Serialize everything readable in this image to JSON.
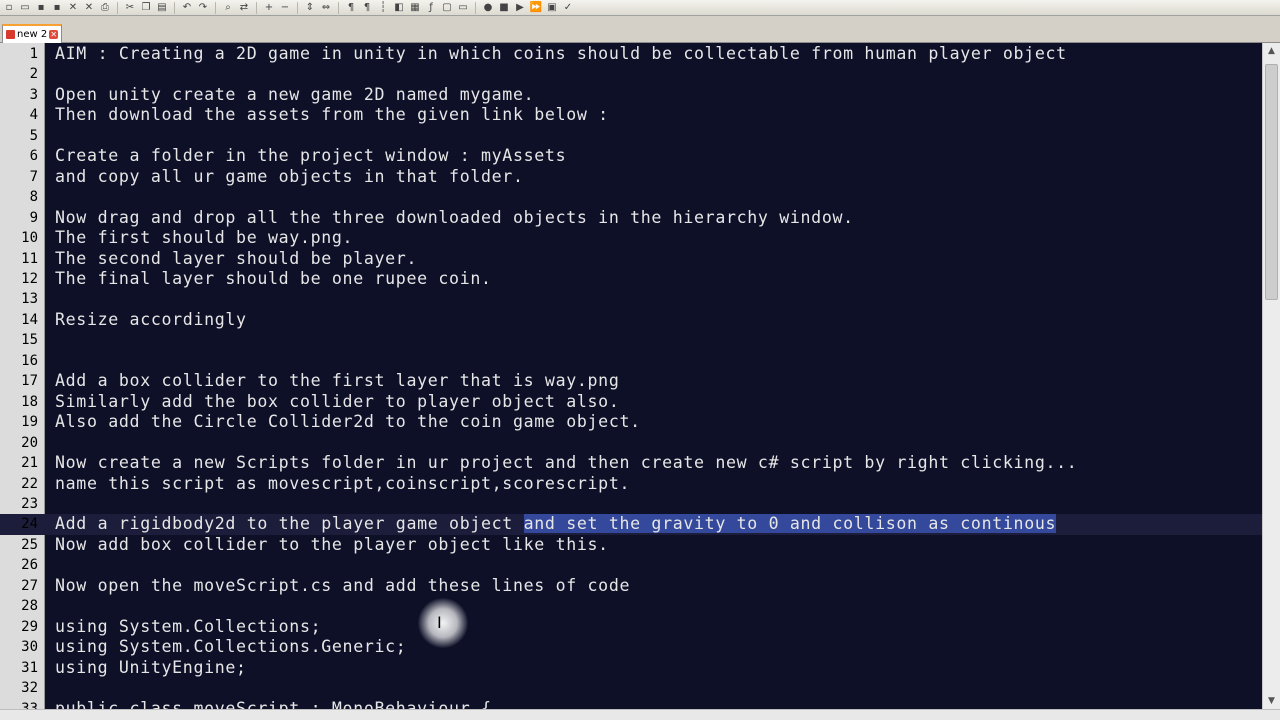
{
  "toolbar": {
    "icons": [
      "new-file-icon",
      "open-file-icon",
      "save-icon",
      "save-all-icon",
      "close-icon",
      "close-all-icon",
      "print-icon",
      "cut-icon",
      "copy-icon",
      "paste-icon",
      "undo-icon",
      "redo-icon",
      "find-icon",
      "replace-icon",
      "zoom-in-icon",
      "zoom-out-icon",
      "sync-vertical-icon",
      "sync-horizontal-icon",
      "word-wrap-icon",
      "show-all-chars-icon",
      "indent-guide-icon",
      "lang-icon",
      "doc-map-icon",
      "function-list-icon",
      "folder-workspace-icon",
      "monitor-icon",
      "record-macro-icon",
      "stop-macro-icon",
      "play-macro-icon",
      "run-macro-multiple-icon",
      "save-macro-icon",
      "spell-check-icon"
    ]
  },
  "tab": {
    "label": "new 2"
  },
  "editor": {
    "lines": [
      {
        "n": "1",
        "text": "AIM : Creating a 2D game in unity in which coins should be collectable from human player object"
      },
      {
        "n": "2",
        "text": ""
      },
      {
        "n": "3",
        "text": "Open unity create a new game 2D named mygame."
      },
      {
        "n": "4",
        "text": "Then download the assets from the given link below :"
      },
      {
        "n": "5",
        "text": ""
      },
      {
        "n": "6",
        "text": "Create a folder in the project window : myAssets"
      },
      {
        "n": "7",
        "text": "and copy all ur game objects in that folder."
      },
      {
        "n": "8",
        "text": ""
      },
      {
        "n": "9",
        "text": "Now drag and drop all the three downloaded objects in the hierarchy window."
      },
      {
        "n": "10",
        "text": "The first should be way.png."
      },
      {
        "n": "11",
        "text": "The second layer should be player."
      },
      {
        "n": "12",
        "text": "The final layer should be one rupee coin."
      },
      {
        "n": "13",
        "text": ""
      },
      {
        "n": "14",
        "text": "Resize accordingly"
      },
      {
        "n": "15",
        "text": ""
      },
      {
        "n": "16",
        "text": ""
      },
      {
        "n": "17",
        "text": "Add a box collider to the first layer that is way.png"
      },
      {
        "n": "18",
        "text": "Similarly add the box collider to player object also."
      },
      {
        "n": "19",
        "text": "Also add the Circle Collider2d to the coin game object."
      },
      {
        "n": "20",
        "text": ""
      },
      {
        "n": "21",
        "text": "Now create a new Scripts folder in ur project and then create new c# script by right clicking..."
      },
      {
        "n": "22",
        "text": "name this script as movescript,coinscript,scorescript."
      },
      {
        "n": "23",
        "text": ""
      },
      {
        "n": "24",
        "text": "Add a rigidbody2d to the player game object ",
        "selected": "and set the gravity to 0 and collison as continous",
        "current": true
      },
      {
        "n": "25",
        "text": "Now add box collider to the player object like this."
      },
      {
        "n": "26",
        "text": ""
      },
      {
        "n": "27",
        "text": "Now open the moveScript.cs and add these lines of code"
      },
      {
        "n": "28",
        "text": ""
      },
      {
        "n": "29",
        "text": "using System.Collections;"
      },
      {
        "n": "30",
        "text": "using System.Collections.Generic;"
      },
      {
        "n": "31",
        "text": "using UnityEngine;"
      },
      {
        "n": "32",
        "text": ""
      },
      {
        "n": "33",
        "text": "public class moveScript : MonoBehaviour {"
      }
    ]
  },
  "colors": {
    "editor_bg": "#0e1028",
    "text": "#e6e6e6",
    "selection": "#34489c",
    "current_line": "#1b1d3a",
    "gutter": "#dcdcdc",
    "tab_accent": "#f8a032"
  }
}
